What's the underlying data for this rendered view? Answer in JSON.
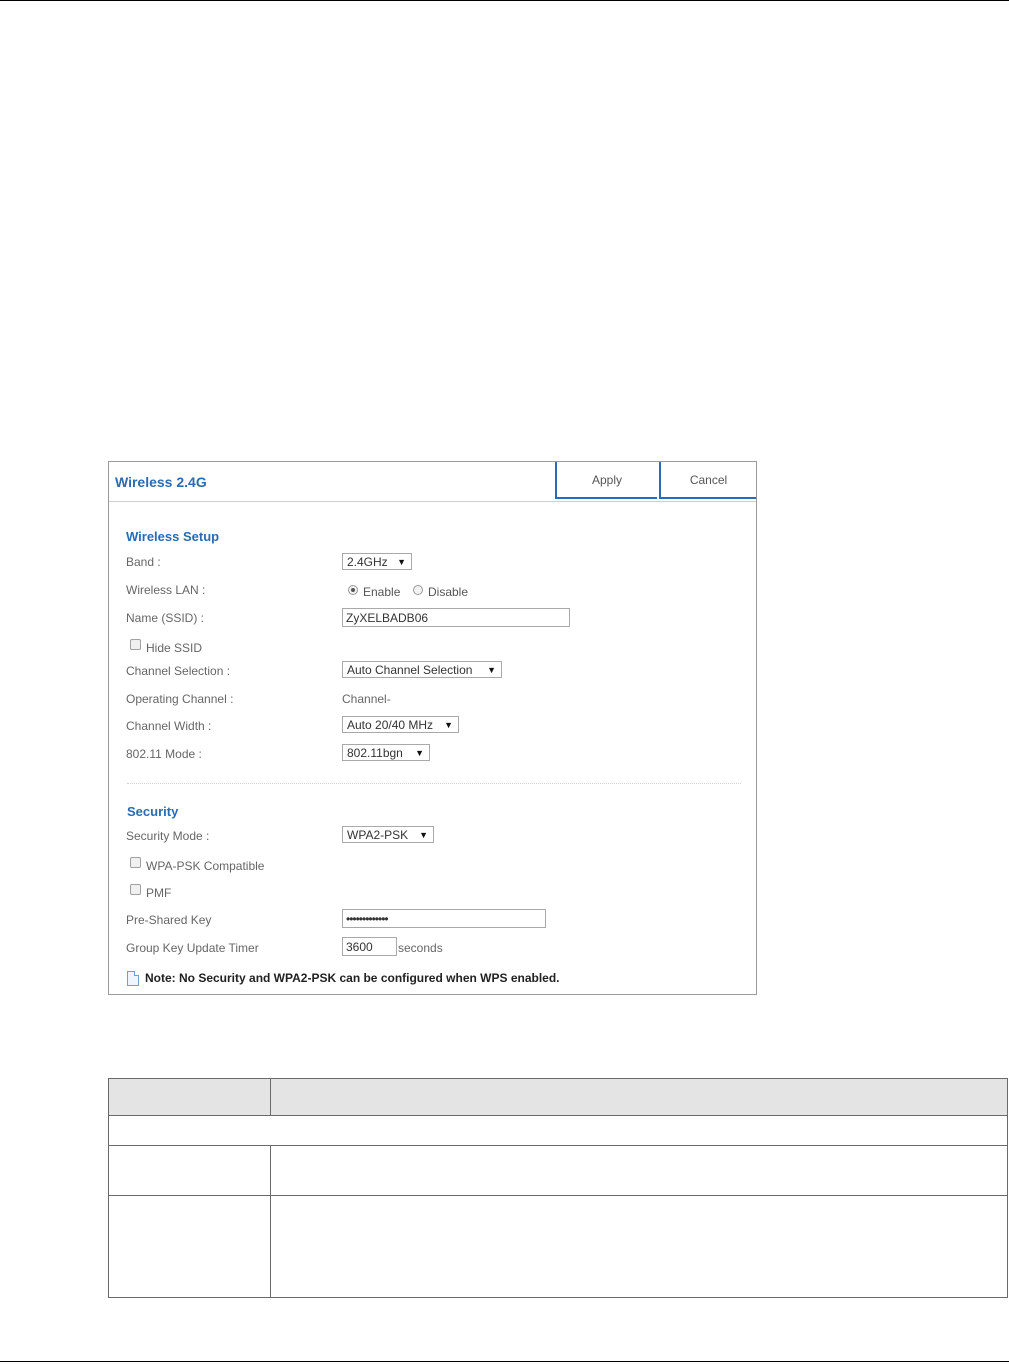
{
  "panel": {
    "title": "Wireless 2.4G",
    "apply_label": "Apply",
    "cancel_label": "Cancel",
    "wireless_setup": {
      "section_title": "Wireless Setup",
      "band_label": "Band :",
      "band_value": "2.4GHz",
      "wireless_lan_label": "Wireless LAN :",
      "enable_label": "Enable",
      "disable_label": "Disable",
      "wireless_lan_selected": "Enable",
      "ssid_label": "Name (SSID) :",
      "ssid_value": "ZyXELBADB06",
      "hide_ssid_label": "Hide SSID",
      "channel_selection_label": "Channel Selection :",
      "channel_selection_value": "Auto Channel Selection",
      "operating_channel_label": "Operating Channel :",
      "operating_channel_value": "Channel-",
      "channel_width_label": "Channel Width :",
      "channel_width_value": "Auto 20/40 MHz",
      "mode_label": "802.11 Mode :",
      "mode_value": "802.11bgn"
    },
    "security": {
      "section_title": "Security",
      "security_mode_label": "Security Mode :",
      "security_mode_value": "WPA2-PSK",
      "wpa_psk_compatible_label": "WPA-PSK Compatible",
      "pmf_label": "PMF",
      "psk_label": "Pre-Shared Key",
      "psk_value": "•••••••••••••",
      "group_key_label": "Group Key Update Timer",
      "group_key_value": "3600",
      "group_key_unit": "seconds"
    },
    "note": "Note: No Security and WPA2-PSK can be configured when WPS enabled."
  },
  "dropdown_arrow": "▼",
  "colors": {
    "accent": "#2a6bb5",
    "label": "#666666",
    "border": "#a9a9a9"
  }
}
